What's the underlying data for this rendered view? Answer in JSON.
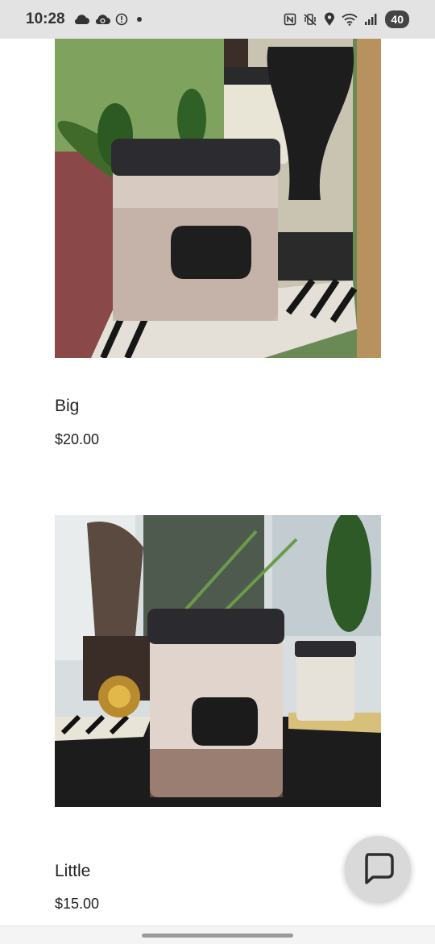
{
  "status_bar": {
    "time": "10:28",
    "battery": "40",
    "left_icons": [
      "cloud-icon",
      "cloud-sync-icon",
      "alert-circle-icon",
      "dot-icon"
    ],
    "right_icons": [
      "nfc-icon",
      "vibrate-mute-icon",
      "location-icon",
      "wifi-icon",
      "signal-icon"
    ]
  },
  "products": [
    {
      "name": "Big",
      "price": "$20.00"
    },
    {
      "name": "Little",
      "price": "$15.00"
    }
  ],
  "chat": {
    "icon": "chat-bubble-icon"
  }
}
